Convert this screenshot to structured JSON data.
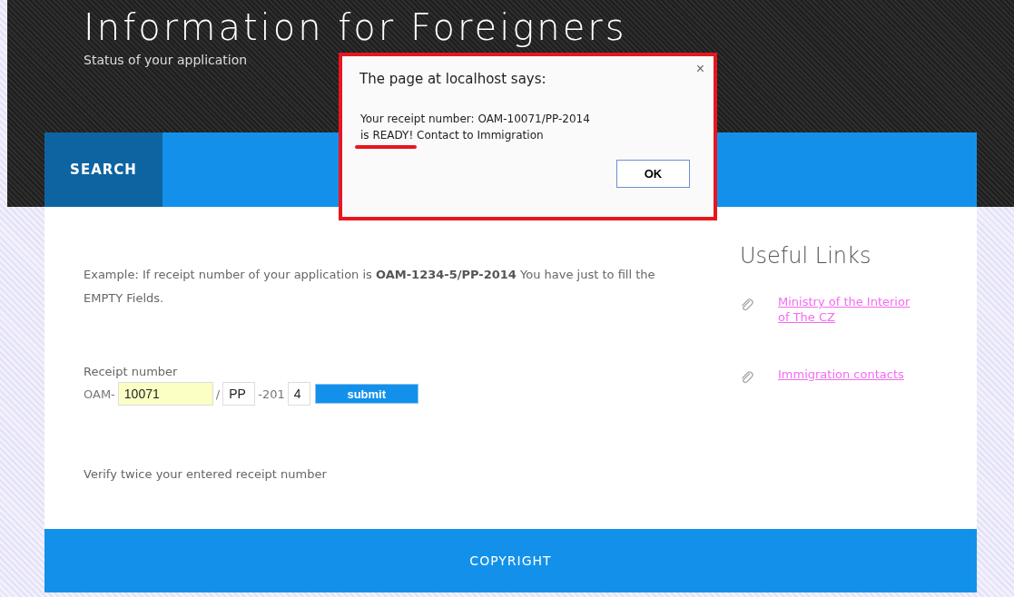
{
  "header": {
    "title": "Information for Foreigners",
    "subtitle": "Status of your application"
  },
  "nav": [
    {
      "label": "SEARCH",
      "selected": true
    }
  ],
  "main": {
    "example": "Example: If receipt number of your application is **OAM-1234-5/PP-2014** You have just to fill the EMPTY Fields.",
    "receipt_label": "Receipt number",
    "receipt_parts": [
      {
        "kind": "text",
        "text": "OAM-"
      },
      {
        "kind": "field",
        "value": "10071",
        "highlighted": true
      },
      {
        "kind": "text",
        "text": "/"
      },
      {
        "kind": "field",
        "value": "PP",
        "highlighted": false
      },
      {
        "kind": "text",
        "text": "-201"
      },
      {
        "kind": "field",
        "value": "4",
        "highlighted": false
      },
      {
        "kind": "button",
        "text": "submit"
      }
    ],
    "note": "Verify twice your entered receipt number"
  },
  "sidebar": {
    "title": "Useful Links",
    "links": [
      "Ministry of the Interior of The CZ",
      "Immigration contacts"
    ]
  },
  "footer": {
    "text": "COPYRIGHT"
  },
  "dialog": {
    "title": "The page at localhost says:",
    "close": "×",
    "message_lines": [
      "Your receipt number: OAM-10071/PP-2014",
      "is READY! Contact to Immigration"
    ],
    "button": "OK"
  }
}
